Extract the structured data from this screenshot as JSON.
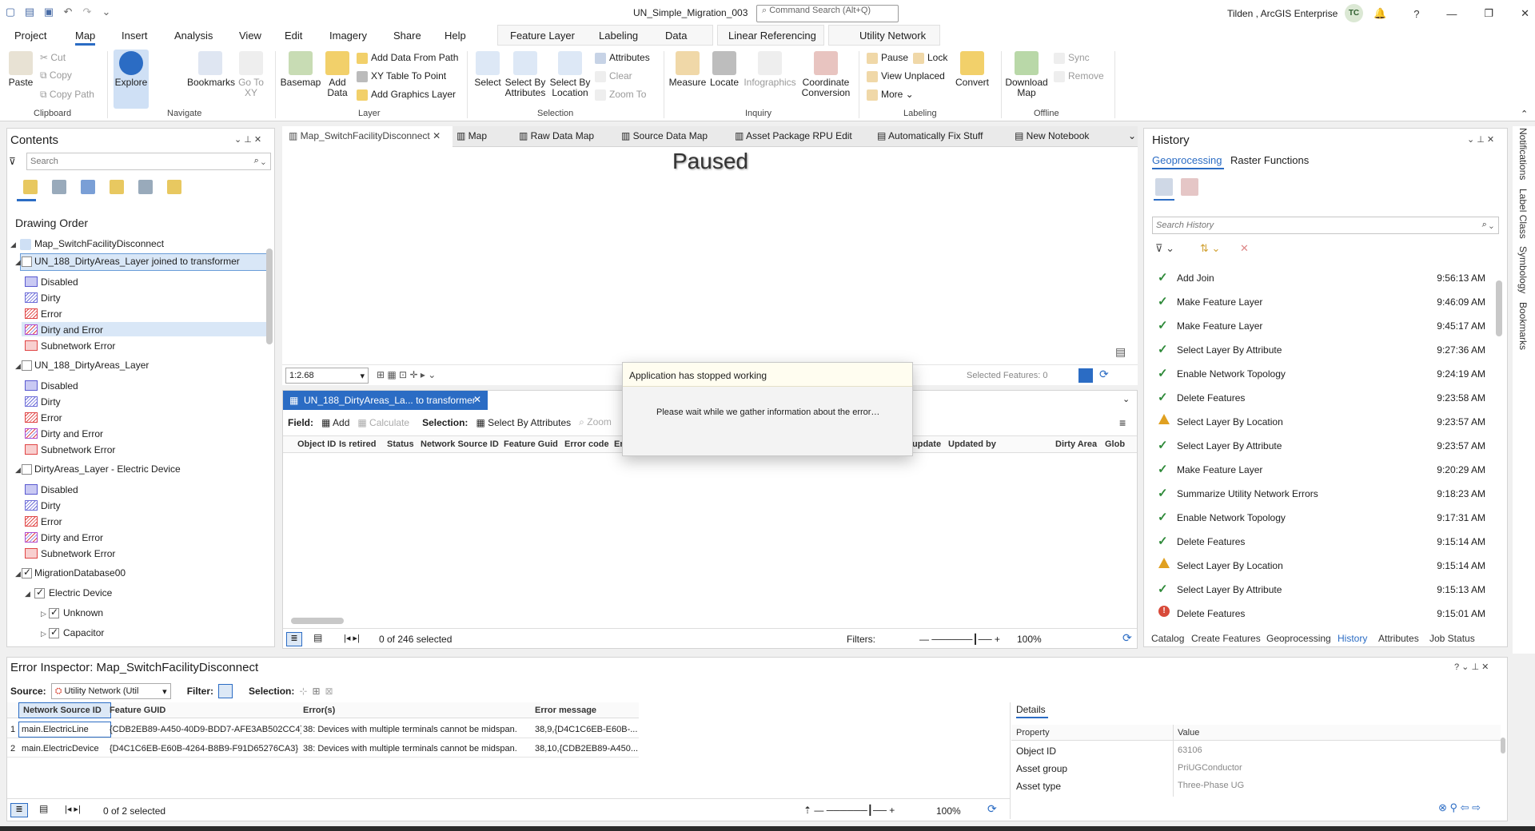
{
  "app": {
    "document_title": "UN_Simple_Migration_003",
    "command_search_placeholder": "Command Search (Alt+Q)",
    "user_label": "Tilden , ArcGIS Enterprise",
    "avatar_initials": "TC"
  },
  "ribbon_tabs": [
    "Project",
    "Map",
    "Insert",
    "Analysis",
    "View",
    "Edit",
    "Imagery",
    "Share",
    "Help",
    "Feature Layer",
    "Labeling",
    "Data",
    "Linear Referencing",
    "Utility Network"
  ],
  "ribbon": {
    "clipboard": {
      "paste": "Paste",
      "cut": "Cut",
      "copy": "Copy",
      "copy_path": "Copy Path",
      "label": "Clipboard"
    },
    "navigate": {
      "explore": "Explore",
      "bookmarks": "Bookmarks",
      "goto": "Go To XY",
      "label": "Navigate"
    },
    "layer": {
      "basemap": "Basemap",
      "add_data": "Add Data",
      "add_from_path": "Add Data From Path",
      "xy_table": "XY Table To Point",
      "add_graphics": "Add Graphics Layer",
      "label": "Layer"
    },
    "selection": {
      "select": "Select",
      "by_attributes": "Select By Attributes",
      "by_location": "Select By Location",
      "attributes": "Attributes",
      "clear": "Clear",
      "zoom_to": "Zoom To",
      "label": "Selection"
    },
    "inquiry": {
      "measure": "Measure",
      "locate": "Locate",
      "infographics": "Infographics",
      "coordinate": "Coordinate Conversion",
      "label": "Inquiry"
    },
    "labeling": {
      "pause": "Pause",
      "lock": "Lock",
      "view_unplaced": "View Unplaced",
      "more": "More",
      "convert": "Convert",
      "label": "Labeling"
    },
    "offline": {
      "download": "Download Map",
      "sync": "Sync",
      "remove": "Remove",
      "label": "Offline"
    }
  },
  "contents": {
    "title": "Contents",
    "search_placeholder": "Search",
    "drawing_order": "Drawing Order",
    "map_name": "Map_SwitchFacilityDisconnect",
    "layer1": "UN_188_DirtyAreas_Layer joined to transformer",
    "layer2": "UN_188_DirtyAreas_Layer",
    "layer3": "DirtyAreas_Layer - Electric Device",
    "layer4": "MigrationDatabase00",
    "group": "Electric Device",
    "sub1": "Unknown",
    "sub2": "Capacitor",
    "legend": [
      "Disabled",
      "Dirty",
      "Error",
      "Dirty and Error",
      "Subnetwork Error"
    ]
  },
  "doc_tabs": [
    "Map_SwitchFacilityDisconnect",
    "Map",
    "Raw Data Map",
    "Source Data Map",
    "Asset Package RPU Edit",
    "Automatically Fix Stuff",
    "New Notebook"
  ],
  "map": {
    "paused_label": "Paused",
    "scale": "1:2.68",
    "selected_features": "Selected Features: 0"
  },
  "table": {
    "tab_label": "UN_188_DirtyAreas_La... to transformer",
    "field_label": "Field:",
    "add": "Add",
    "calculate": "Calculate",
    "selection_label": "Selection:",
    "select_by_attr": "Select By Attributes",
    "zoom": "Zoom",
    "columns": [
      "Object ID",
      "Is retired",
      "Status",
      "Network Source ID",
      "Feature Guid",
      "Error code",
      "Er",
      "update",
      "Updated by",
      "Dirty Area",
      "Glob"
    ],
    "selected_count": "0 of 246 selected",
    "filters": "Filters:",
    "zoom_pct": "100%"
  },
  "dialog": {
    "title": "Application has stopped working",
    "message": "Please wait while we gather information about the error…"
  },
  "history": {
    "title": "History",
    "tabs": [
      "Geoprocessing",
      "Raster Functions"
    ],
    "search_placeholder": "Search History",
    "items": [
      {
        "name": "Add Join",
        "time": "9:56:13 AM",
        "status": "ok"
      },
      {
        "name": "Make Feature Layer",
        "time": "9:46:09 AM",
        "status": "ok"
      },
      {
        "name": "Make Feature Layer",
        "time": "9:45:17 AM",
        "status": "ok"
      },
      {
        "name": "Select Layer By Attribute",
        "time": "9:27:36 AM",
        "status": "ok"
      },
      {
        "name": "Enable Network Topology",
        "time": "9:24:19 AM",
        "status": "ok"
      },
      {
        "name": "Delete Features",
        "time": "9:23:58 AM",
        "status": "ok"
      },
      {
        "name": "Select Layer By Location",
        "time": "9:23:57 AM",
        "status": "warn"
      },
      {
        "name": "Select Layer By Attribute",
        "time": "9:23:57 AM",
        "status": "ok"
      },
      {
        "name": "Make Feature Layer",
        "time": "9:20:29 AM",
        "status": "ok"
      },
      {
        "name": "Summarize Utility Network Errors",
        "time": "9:18:23 AM",
        "status": "ok"
      },
      {
        "name": "Enable Network Topology",
        "time": "9:17:31 AM",
        "status": "ok"
      },
      {
        "name": "Delete Features",
        "time": "9:15:14 AM",
        "status": "ok"
      },
      {
        "name": "Select Layer By Location",
        "time": "9:15:14 AM",
        "status": "warn"
      },
      {
        "name": "Select Layer By Attribute",
        "time": "9:15:13 AM",
        "status": "ok"
      },
      {
        "name": "Delete Features",
        "time": "9:15:01 AM",
        "status": "error"
      }
    ],
    "bottom_tabs": [
      "Catalog",
      "Create Features",
      "Geoprocessing",
      "History",
      "Attributes",
      "Job Status"
    ]
  },
  "side_tabs": [
    "Notifications",
    "Label Class",
    "Symbology",
    "Bookmarks"
  ],
  "error_inspector": {
    "title": "Error Inspector: Map_SwitchFacilityDisconnect",
    "source_label": "Source:",
    "source_value": "Utility Network (Util",
    "filter_label": "Filter:",
    "selection_label": "Selection:",
    "columns": [
      "Network Source ID",
      "Feature GUID",
      "Error(s)",
      "Error message"
    ],
    "rows": [
      {
        "n": "1",
        "src": "main.ElectricLine",
        "guid": "{CDB2EB89-A450-40D9-BDD7-AFE3AB502CC4}",
        "err": "38: Devices with multiple terminals cannot be midspan.",
        "msg": "38,9,{D4C1C6EB-E60B-..."
      },
      {
        "n": "2",
        "src": "main.ElectricDevice",
        "guid": "{D4C1C6EB-E60B-4264-B8B9-F91D65276CA3}",
        "err": "38: Devices with multiple terminals cannot be midspan.",
        "msg": "38,10,{CDB2EB89-A450..."
      }
    ],
    "selected_count": "0 of 2 selected",
    "zoom_pct": "100%",
    "details": {
      "tab": "Details",
      "prop_header": "Property",
      "value_header": "Value",
      "rows": [
        {
          "p": "Object ID",
          "v": "63106"
        },
        {
          "p": "Asset group",
          "v": "PriUGConductor"
        },
        {
          "p": "Asset type",
          "v": "Three-Phase UG"
        }
      ]
    }
  }
}
